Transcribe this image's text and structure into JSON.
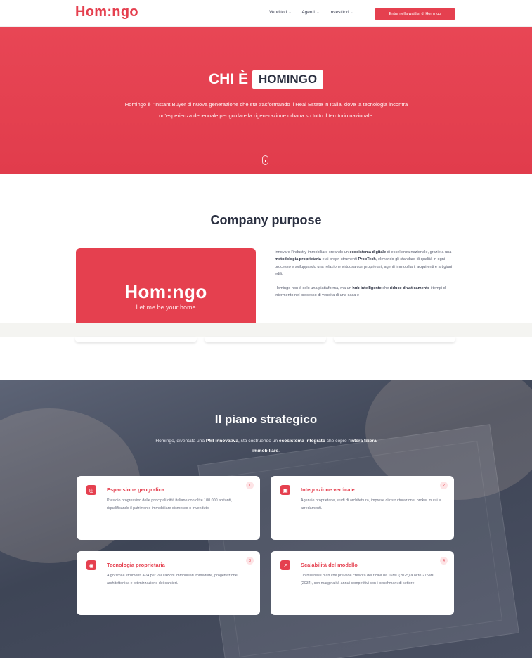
{
  "nav": {
    "logo": "Hom:ngo",
    "menu": [
      {
        "label": "Venditori"
      },
      {
        "label": "Agenti"
      },
      {
        "label": "Investitori"
      }
    ],
    "cta": "Entra nella waitlist di Homingo"
  },
  "hero": {
    "title_prefix": "CHI È",
    "title_boxed": "HOMINGO",
    "text": "Homingo è l'Instant Buyer di nuova generazione che sta trasformando il Real Estate in Italia, dove la tecnologia incontra un'esperienza decennale per guidare la rigenerazione urbana su tutto il territorio nazionale."
  },
  "purpose": {
    "title": "Company purpose",
    "brand": "Hom:ngo",
    "tagline": "Let me be your home",
    "p1_a": "Innovare l'industry immobiliare creando un ",
    "p1_b": "ecosistema digitale",
    "p1_c": " di eccellenza nazionale, grazie a una ",
    "p1_d": "metodologia proprietaria",
    "p1_e": " e ai propri strumenti ",
    "p1_f": "PropTech",
    "p1_g": ", elevando gli standard di qualità in ogni processo e sviluppando una relazione virtuosa con proprietari, agenti immobiliari, acquirenti e artigiani edili.",
    "p2_a": "Homingo non è solo una piattaforma, ma un ",
    "p2_b": "hub intelligente",
    "p2_c": " che ",
    "p2_d": "riduce drasticamente",
    "p2_e": " i tempi di intermento nel processo di vendita di una casa e"
  },
  "strategy": {
    "title": "Il piano strategico",
    "sub_a": "Homingo, diventata una ",
    "sub_b": "PMI innovativa",
    "sub_c": ", sta costruendo un ",
    "sub_d": "ecosistema integrato",
    "sub_e": " che copre l'",
    "sub_f": "intera filiera immobiliare",
    "sub_g": ".",
    "cards": [
      {
        "num": "1",
        "icon": "◎",
        "title": "Espansione geografica",
        "desc": "Presidio progressivo delle principali città italiane con oltre 100.000 abitanti, riqualificando il patrimonio immobiliare dismesso o invenduto."
      },
      {
        "num": "2",
        "icon": "▣",
        "title": "Integrazione verticale",
        "desc": "Agenzie proprietarie, studi di architettura, imprese di ristrutturazione, broker mutui e arredamenti."
      },
      {
        "num": "3",
        "icon": "◉",
        "title": "Tecnologia proprietaria",
        "desc": "Algoritmi e strumenti AI/A per valutazioni immobiliari immediate, progettazione architettonica e ottimizzazione dei cantieri."
      },
      {
        "num": "4",
        "icon": "↗",
        "title": "Scalabilità del modello",
        "desc": "Un business plan che prevede crescita dei ricavi da 16M€ (2025) a oltre 275M€ (2034), con marginalità annui competitivi con i benchmark di settore."
      }
    ]
  }
}
